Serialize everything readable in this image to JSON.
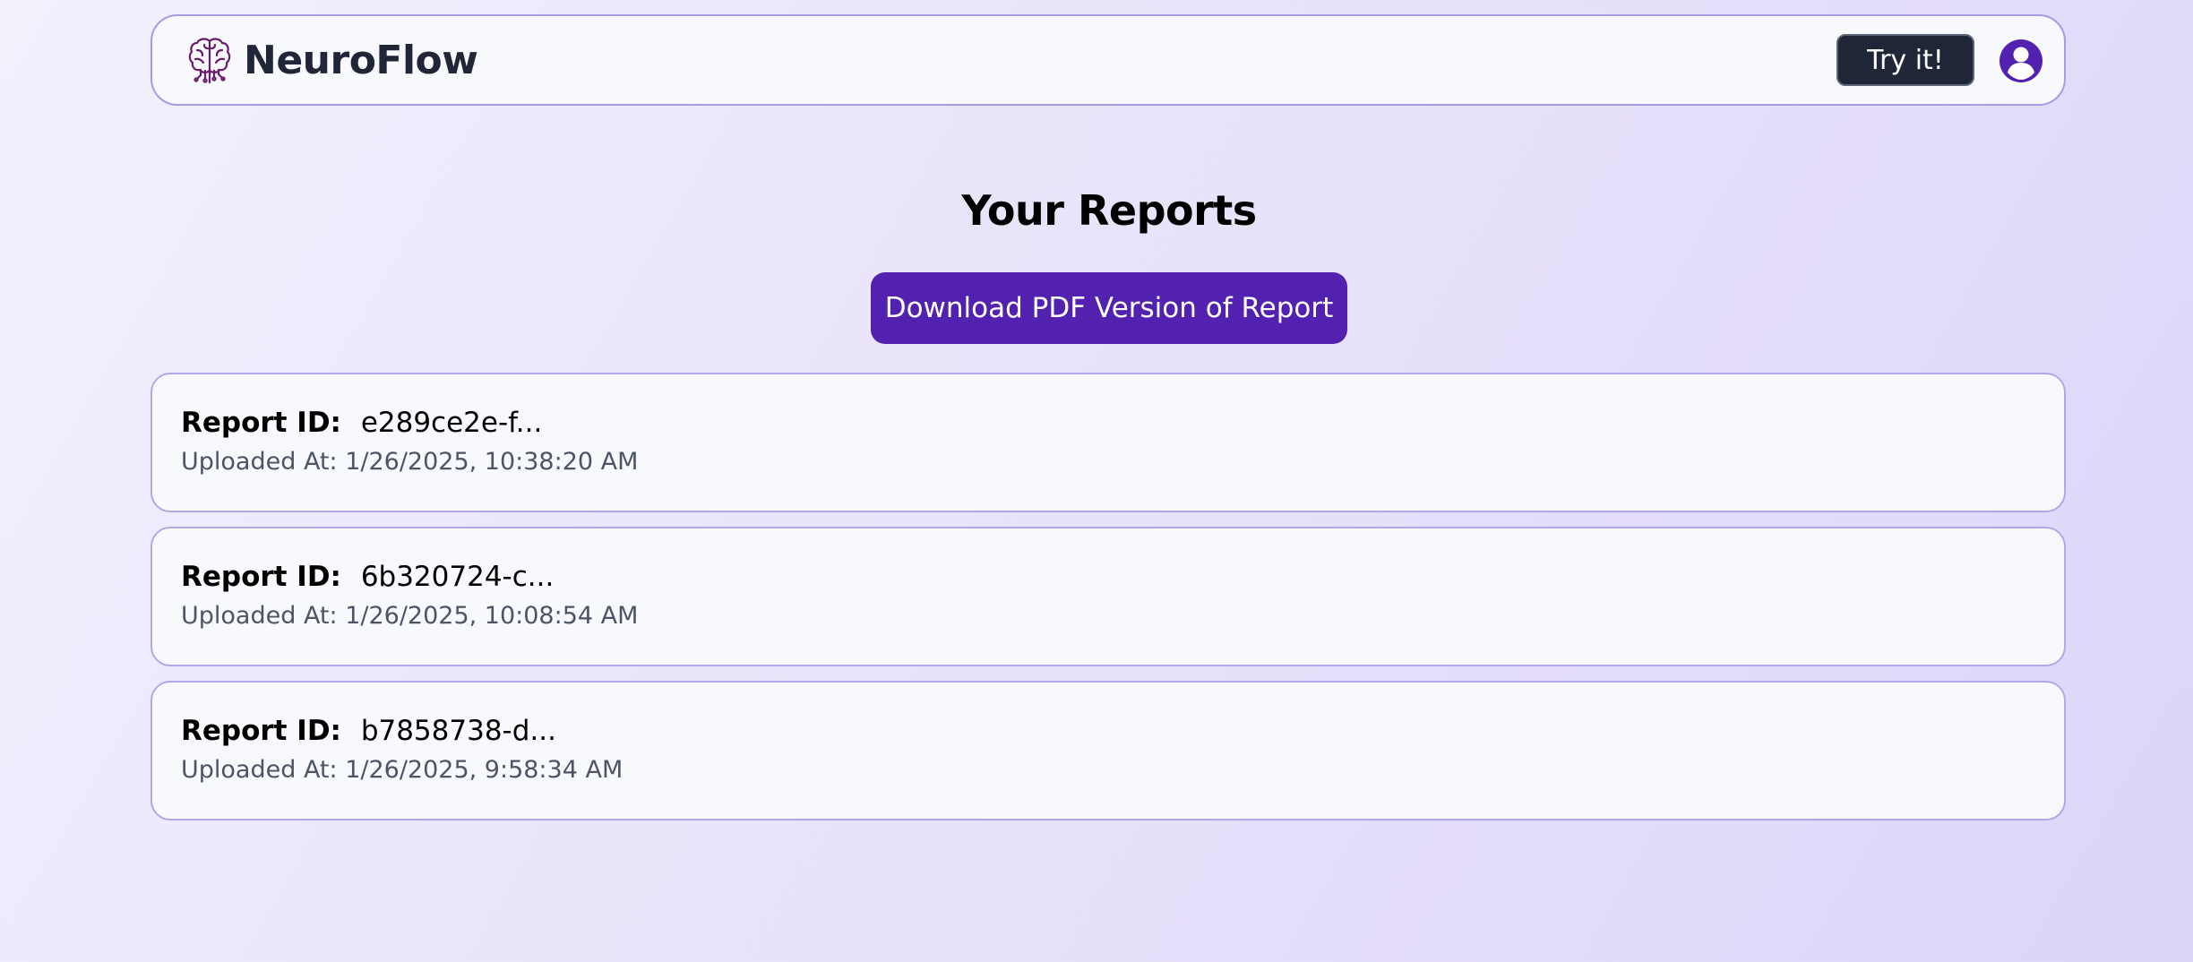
{
  "header": {
    "brand_name": "NeuroFlow",
    "brand_icon": "brain-circuit-icon",
    "try_button_label": "Try it!",
    "profile_icon": "user-circle-icon"
  },
  "main": {
    "title": "Your Reports",
    "download_button_label": "Download PDF Version of Report",
    "reports": [
      {
        "id_label": "Report ID:",
        "id_value": "e289ce2e-f...",
        "uploaded_text": "Uploaded At: 1/26/2025, 10:38:20 AM"
      },
      {
        "id_label": "Report ID:",
        "id_value": "6b320724-c...",
        "uploaded_text": "Uploaded At: 1/26/2025, 10:08:54 AM"
      },
      {
        "id_label": "Report ID:",
        "id_value": "b7858738-d...",
        "uploaded_text": "Uploaded At: 1/26/2025, 9:58:34 AM"
      }
    ]
  },
  "colors": {
    "accent": "#5321b0",
    "brand_icon": "#6a1b6e",
    "dark": "#1e2638",
    "border": "#a99ae6",
    "muted_text": "#4b5566"
  }
}
